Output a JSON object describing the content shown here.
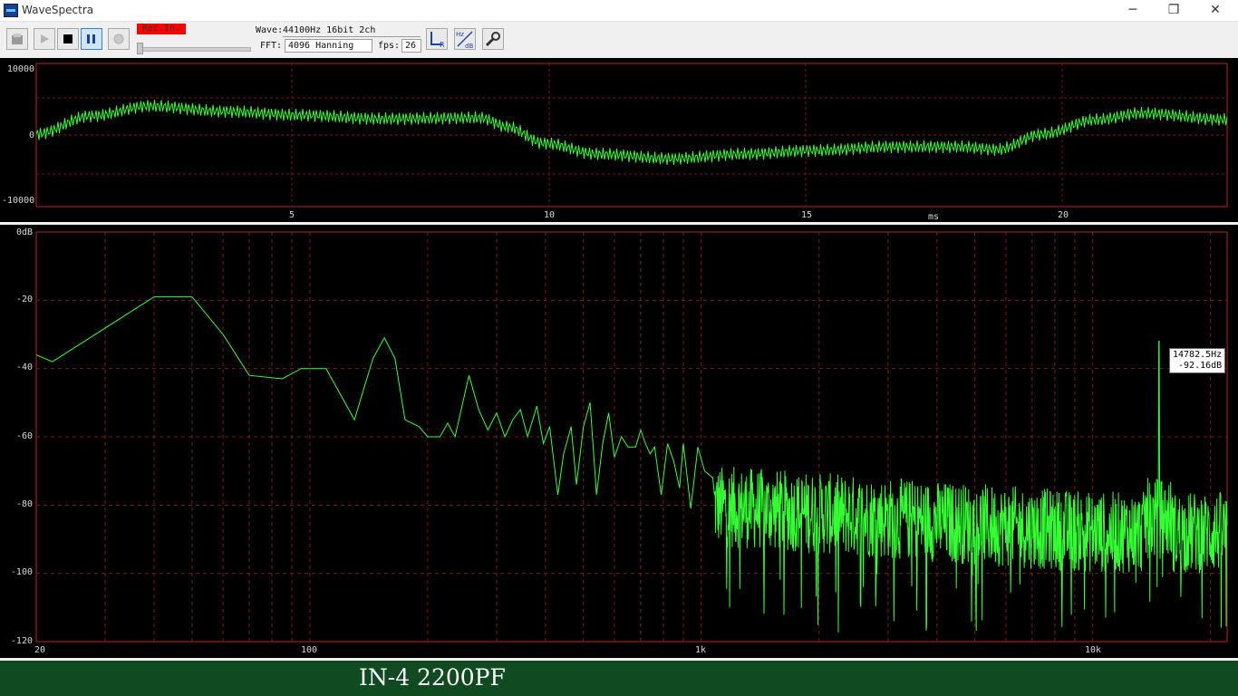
{
  "window": {
    "title": "WaveSpectra",
    "min": "─",
    "restore": "❐",
    "close": "✕"
  },
  "toolbar": {
    "rec_label": "Rec.In.",
    "wave_label": "Wave:",
    "wave_value": "44100Hz 16bit 2ch",
    "fft_label": "FFT:",
    "fft_value": "4096 Hanning",
    "fps_label": "fps:",
    "fps_value": "26",
    "lr_label": "L",
    "lr_sub": "R",
    "hz_label": "Hz",
    "db_label": "dB"
  },
  "wave_panel": {
    "y_ticks": [
      "10000",
      "0",
      "-10000"
    ],
    "x_ticks": [
      "5",
      "10",
      "15",
      "20"
    ],
    "x_unit": "ms"
  },
  "spectrum_panel": {
    "y_ticks": [
      "0dB",
      "-20",
      "-40",
      "-60",
      "-80",
      "-100",
      "-120"
    ],
    "x_ticks": [
      "20",
      "100",
      "1k",
      "10k"
    ],
    "tooltip_freq": "14782.5Hz",
    "tooltip_db": "-92.16dB"
  },
  "caption": "IN-4 2200PF",
  "colors": {
    "trace": "#33ff33",
    "grid": "#7a1a1a",
    "frame": "#c02020",
    "caption_bg": "#0f4a20",
    "rec": "#ff0000"
  }
}
